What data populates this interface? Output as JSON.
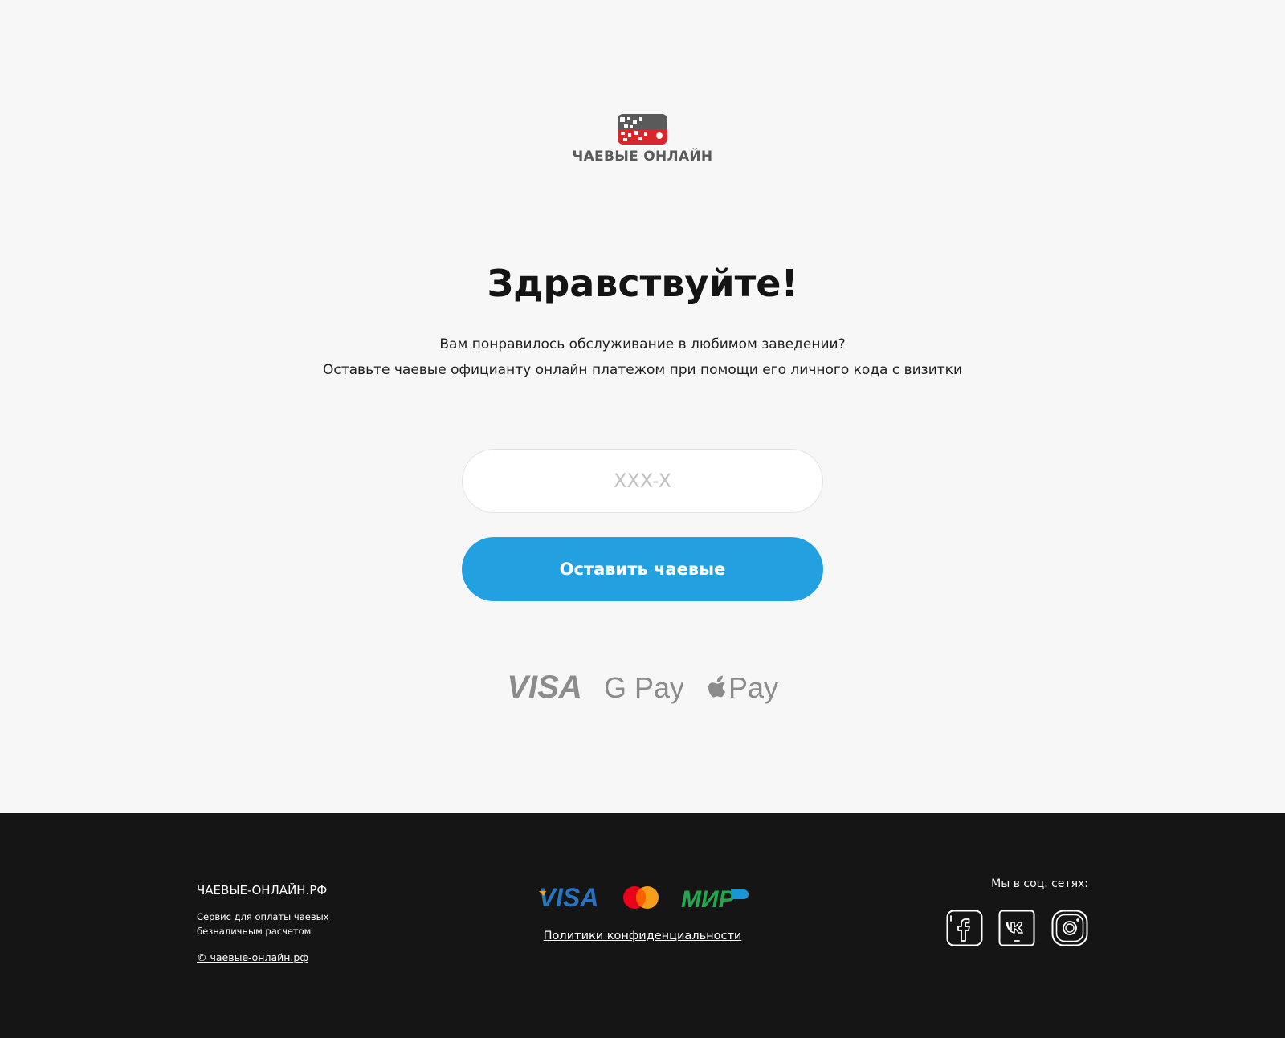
{
  "header": {
    "logo_text": "ЧАЕВЫЕ ОНЛАЙН"
  },
  "main": {
    "title": "Здравствуйте!",
    "subtitle_line1": "Вам понравилось обслуживание в любимом заведении?",
    "subtitle_line2": "Оставьте чаевые официанту онлайн платежом при помощи его личного кода с визитки",
    "code_input": {
      "placeholder": "XXX-X",
      "value": ""
    },
    "submit_label": "Оставить чаевые",
    "payment_methods": [
      "VISA",
      "G Pay",
      "Apple Pay"
    ]
  },
  "footer": {
    "brand": "ЧАЕВЫЕ-ОНЛАЙН.РФ",
    "description_line1": "Сервис для оплаты чаевых",
    "description_line2": "безналичным расчетом",
    "copyright": "© чаевые-онлайн.рф",
    "card_logos": [
      "VISA",
      "Mastercard",
      "МИР"
    ],
    "privacy_link": "Политики конфиденциальности",
    "social_title": "Мы в соц. сетях:",
    "social_icons": [
      "facebook-icon",
      "vk-icon",
      "instagram-icon"
    ]
  },
  "colors": {
    "accent": "#22a0e0",
    "footer_bg": "#151515",
    "page_bg": "#f7f7f7",
    "logo_red": "#d9262d",
    "logo_gray": "#5a5a5a"
  }
}
